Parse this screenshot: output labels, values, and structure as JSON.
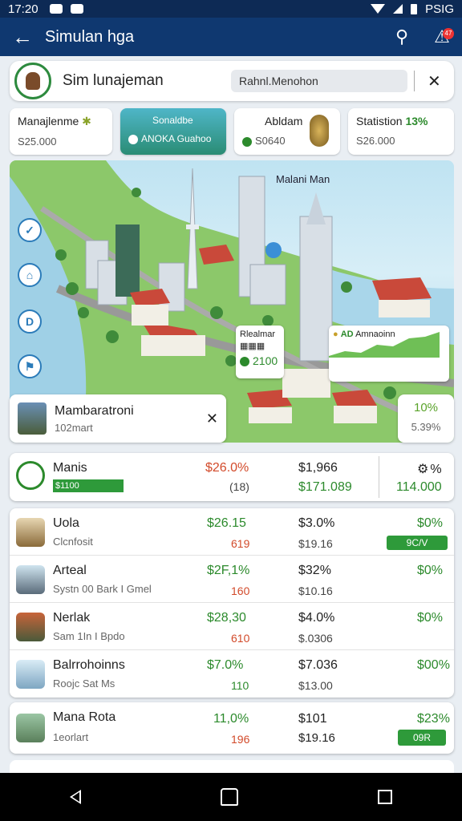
{
  "status": {
    "time": "17:20",
    "right_text": "PSIG"
  },
  "appbar": {
    "title": "Simulan hga",
    "back_icon": "arrow-left-icon",
    "search_icon": "search-icon",
    "alerts_badge": "47"
  },
  "search": {
    "title": "Sim lunajeman",
    "query": "Rahnl.Menohon"
  },
  "tiles": [
    {
      "title": "Manajlenme",
      "value": "S25.000"
    },
    {
      "title": "Sonaldbe",
      "value": "ANOKA Guahoo"
    },
    {
      "title": "Abldam",
      "value": "S0640"
    },
    {
      "title": "Statistion",
      "pct": "13%",
      "value": "S26.000"
    }
  ],
  "map": {
    "label": "Malani Man",
    "popup_left": {
      "title": "Rlealmar",
      "value": "2100"
    },
    "popup_right": {
      "title": "Amnaoinn",
      "code": "AD"
    },
    "fab_icons": [
      "check-icon",
      "tent-icon",
      "id-icon",
      "flag-icon"
    ]
  },
  "place": {
    "name": "Mambaratroni",
    "sub": "102mart",
    "pct_a": "10%",
    "pct_b": "5.39%"
  },
  "summary": {
    "name": "Manis",
    "bar": "$1100",
    "c2a": "$26.0%",
    "c2b": "(18)",
    "c3a": "$1,966",
    "c3b": "$171.089",
    "c4a": "%",
    "c4b": "114.000"
  },
  "rows": [
    {
      "name": "Uola",
      "sub": "Clcnfosit",
      "c2a": "$26.15",
      "c2b": "619",
      "c3a": "$3.0%",
      "c3b": "$19.16",
      "c4a": "$0%",
      "c4b": "9C/V"
    },
    {
      "name": "Arteal",
      "sub": "Systn 00 Bark I Gmel",
      "c2a": "$2F,1%",
      "c2b": "160",
      "c3a": "$32%",
      "c3b": "$10.16",
      "c4a": "$0%",
      "c4b": ""
    },
    {
      "name": "Nerlak",
      "sub": "Sam 1In I Bpdo",
      "c2a": "$28,30",
      "c2b": "610",
      "c3a": "$4.0%",
      "c3b": "$.0306",
      "c4a": "$0%",
      "c4b": ""
    },
    {
      "name": "Balrrohoinns",
      "sub": "Roojc Sat Ms",
      "c2a": "$7.0%",
      "c2b": "110",
      "c3a": "$7.036",
      "c3b": "$13.00",
      "c4a": "$00%",
      "c4b": ""
    }
  ],
  "card2": {
    "name": "Mana Rota",
    "sub": "1eorlart",
    "c2a": "11,0%",
    "c2b": "196",
    "c3a": "$101",
    "c3b": "$19.16",
    "c4a": "$23%",
    "c4b": "09R"
  },
  "colors": {
    "appbar": "#0f3870",
    "accent_green": "#2e9a3a",
    "accent_red": "#d24a2a"
  }
}
